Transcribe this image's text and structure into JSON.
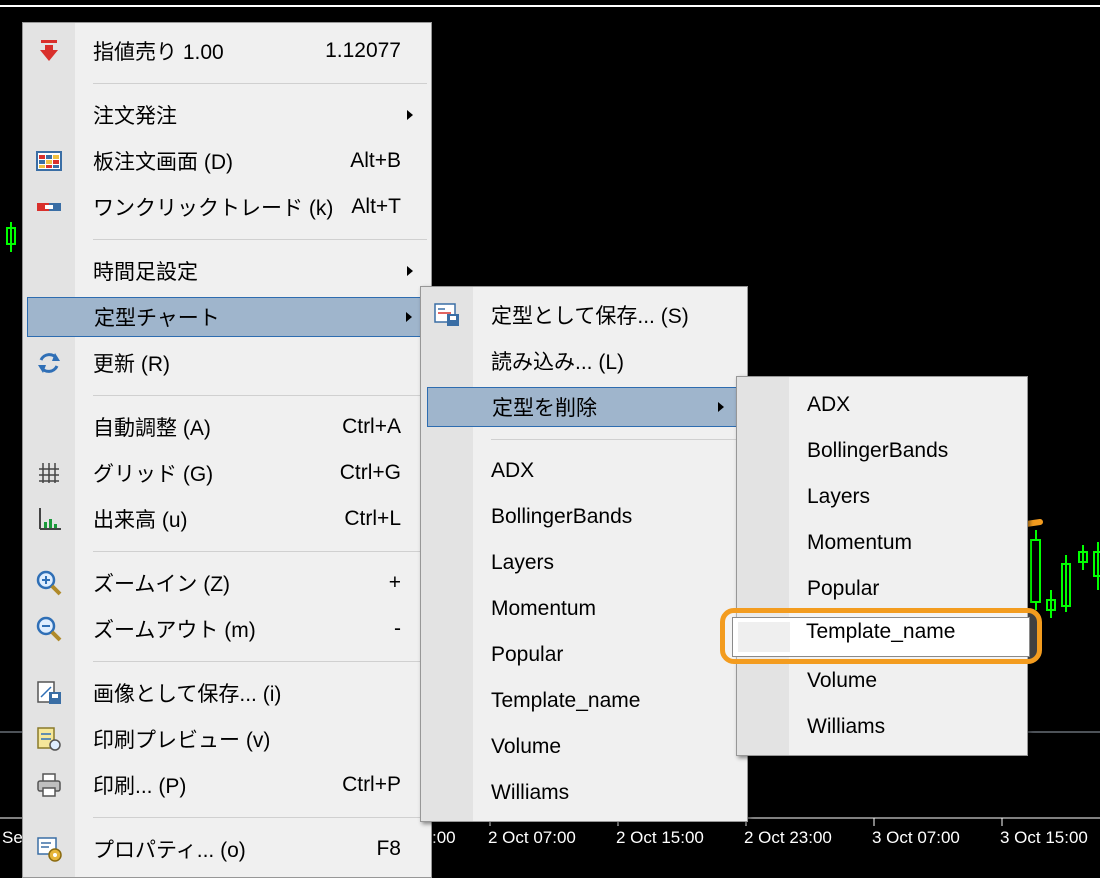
{
  "chart": {
    "time_labels": [
      "Se",
      ":00",
      "2 Oct 07:00",
      "2 Oct 15:00",
      "2 Oct 23:00",
      "3 Oct 07:00",
      "3 Oct 15:00"
    ]
  },
  "main_menu": {
    "items": [
      {
        "label": "指値売り 1.00",
        "shortcut": "1.12077",
        "icon": "sell-arrow-icon"
      },
      {
        "label": "注文発注",
        "submenu": true
      },
      {
        "label": "板注文画面 (D)",
        "shortcut": "Alt+B",
        "icon": "order-book-icon"
      },
      {
        "label": "ワンクリックトレード (k)",
        "shortcut": "Alt+T",
        "icon": "one-click-trade-icon"
      },
      {
        "label": "時間足設定",
        "submenu": true
      },
      {
        "label": "定型チャート",
        "submenu": true,
        "highlighted": true
      },
      {
        "label": "更新 (R)",
        "icon": "refresh-icon"
      },
      {
        "label": "自動調整 (A)",
        "shortcut": "Ctrl+A"
      },
      {
        "label": "グリッド (G)",
        "shortcut": "Ctrl+G",
        "icon": "grid-icon"
      },
      {
        "label": "出来高 (u)",
        "shortcut": "Ctrl+L",
        "icon": "volume-icon"
      },
      {
        "label": "ズームイン (Z)",
        "shortcut": "+",
        "icon": "zoom-in-icon"
      },
      {
        "label": "ズームアウト (m)",
        "shortcut": "-",
        "icon": "zoom-out-icon"
      },
      {
        "label": "画像として保存... (i)",
        "icon": "save-image-icon"
      },
      {
        "label": "印刷プレビュー (v)",
        "icon": "print-preview-icon"
      },
      {
        "label": "印刷... (P)",
        "shortcut": "Ctrl+P",
        "icon": "printer-icon"
      },
      {
        "label": "プロパティ... (o)",
        "shortcut": "F8",
        "icon": "properties-icon"
      }
    ]
  },
  "template_menu": {
    "items": [
      {
        "label": "定型として保存... (S)",
        "icon": "save-template-icon"
      },
      {
        "label": "読み込み... (L)"
      },
      {
        "label": "定型を削除",
        "submenu": true,
        "highlighted": true
      },
      {
        "label": "ADX"
      },
      {
        "label": "BollingerBands"
      },
      {
        "label": "Layers"
      },
      {
        "label": "Momentum"
      },
      {
        "label": "Popular"
      },
      {
        "label": "Template_name"
      },
      {
        "label": "Volume"
      },
      {
        "label": "Williams"
      }
    ]
  },
  "delete_menu": {
    "items": [
      {
        "label": "ADX"
      },
      {
        "label": "BollingerBands"
      },
      {
        "label": "Layers"
      },
      {
        "label": "Momentum"
      },
      {
        "label": "Popular"
      },
      {
        "label": "Template_name",
        "selected": true
      },
      {
        "label": "Volume"
      },
      {
        "label": "Williams"
      }
    ]
  },
  "colors": {
    "highlight": "#9fb5cc",
    "highlight_border": "#2d6cb0",
    "callout": "#f39c1f",
    "candle": "#00ff00"
  }
}
